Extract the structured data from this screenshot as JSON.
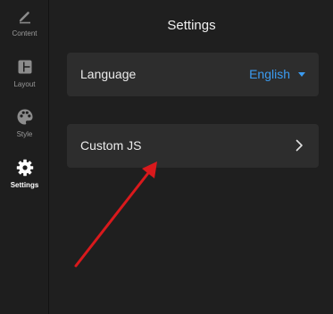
{
  "sidebar": {
    "items": [
      {
        "label": "Content",
        "icon": "pencil-icon",
        "active": false
      },
      {
        "label": "Layout",
        "icon": "layout-icon",
        "active": false
      },
      {
        "label": "Style",
        "icon": "palette-icon",
        "active": false
      },
      {
        "label": "Settings",
        "icon": "gear-icon",
        "active": true
      }
    ]
  },
  "main": {
    "title": "Settings",
    "language": {
      "label": "Language",
      "value": "English"
    },
    "custom_js": {
      "label": "Custom JS"
    }
  },
  "colors": {
    "accent": "#3b9bf0",
    "background": "#1f1f1f",
    "row_background": "#2d2d2d",
    "annotation_arrow": "#d9191c"
  }
}
